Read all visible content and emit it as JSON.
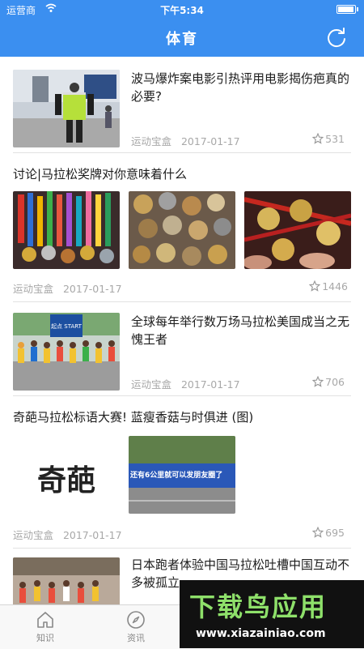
{
  "status_bar": {
    "carrier": "运营商",
    "time": "下午5:34",
    "battery_level": 0.85
  },
  "nav": {
    "title": "体育"
  },
  "feed": [
    {
      "title": "波马爆炸案电影引热评用电影揭伤疤真的必要?",
      "source": "运动宝盒",
      "date": "2017-01-17",
      "likes": "531"
    },
    {
      "title": "讨论|马拉松奖牌对你意味着什么",
      "source": "运动宝盒",
      "date": "2017-01-17",
      "likes": "1446"
    },
    {
      "title": "全球每年举行数万场马拉松美国成当之无愧王者",
      "source": "运动宝盒",
      "date": "2017-01-17",
      "likes": "706",
      "banner_text": "起点 START"
    },
    {
      "title": "奇葩马拉松标语大赛! 蓝瘦香菇与时俱进 (图)",
      "source": "运动宝盒",
      "date": "2017-01-17",
      "likes": "695",
      "thumb_text": "奇葩",
      "banner_text": "还有6公里就可以发朋友圈了"
    },
    {
      "title": "日本跑者体验中国马拉松吐槽中国互动不多被孤立"
    }
  ],
  "tabs": [
    {
      "label": "知识"
    },
    {
      "label": "资讯"
    }
  ],
  "watermark": {
    "brand": "下载鸟应用",
    "url": "www.xiazainiao.com"
  }
}
